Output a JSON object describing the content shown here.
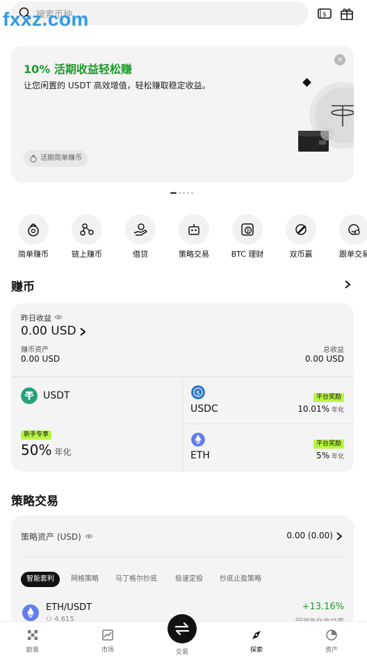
{
  "search": {
    "placeholder": "搜索币种"
  },
  "watermark": "fxxz.com",
  "banner": {
    "title": "10% 活期收益轻松赚",
    "subtitle": "让您闲置的 USDT 高效增值，轻松赚取稳定收益。",
    "close": "×",
    "chip": "活期简单赚币"
  },
  "quick_actions": [
    {
      "label": "简单赚币",
      "icon": "money-bag-icon"
    },
    {
      "label": "链上赚币",
      "icon": "chain-nodes-icon"
    },
    {
      "label": "借贷",
      "icon": "loan-hand-icon"
    },
    {
      "label": "策略交易",
      "icon": "robot-icon"
    },
    {
      "label": "BTC 理财",
      "icon": "btc-vault-icon"
    },
    {
      "label": "双币赢",
      "icon": "dual-coin-icon"
    },
    {
      "label": "跟单交易",
      "icon": "copy-trade-icon"
    }
  ],
  "earn": {
    "section_title": "赚币",
    "yesterday_label": "昨日收益",
    "yesterday_value": "0.00 USD",
    "assets_label": "赚币资产",
    "assets_value": "0.00 USD",
    "total_label": "总收益",
    "total_value": "0.00 USD",
    "products": {
      "usdt": {
        "name": "USDT",
        "tag": "新手专享",
        "apr": "50%",
        "apr_unit": "年化"
      },
      "usdc": {
        "name": "USDC",
        "tag": "平台奖励",
        "apr": "10.01%",
        "apr_unit": "年化"
      },
      "eth": {
        "name": "ETH",
        "tag": "平台奖励",
        "apr": "5%",
        "apr_unit": "年化"
      }
    }
  },
  "strategy": {
    "section_title": "策略交易",
    "assets_label": "策略资产 (USD)",
    "assets_value": "0.00 (0.00)",
    "tabs": [
      "智能套利",
      "网格策略",
      "马丁格尔抄底",
      "极速定投",
      "抄底止盈策略"
    ],
    "item": {
      "pair": "ETH/USDT",
      "count": "4,615",
      "pct": "+13.16%",
      "pct_label": "回测年化收益率"
    }
  },
  "bottom_nav": {
    "items": [
      {
        "label": "欧易",
        "icon": "okx-logo-icon"
      },
      {
        "label": "市场",
        "icon": "market-chart-icon"
      },
      {
        "label": "交易",
        "icon": "swap-arrows-icon"
      },
      {
        "label": "探索",
        "icon": "compass-icon"
      },
      {
        "label": "资产",
        "icon": "pie-chart-icon"
      }
    ],
    "active": "探索"
  },
  "colors": {
    "accent_green": "#1a9a2a",
    "tag_green": "#b8f542",
    "watermark_blue": "#2f9be8",
    "usdt_teal": "#26a17b",
    "usdc_blue": "#2775ca",
    "eth_purple": "#627eea"
  }
}
